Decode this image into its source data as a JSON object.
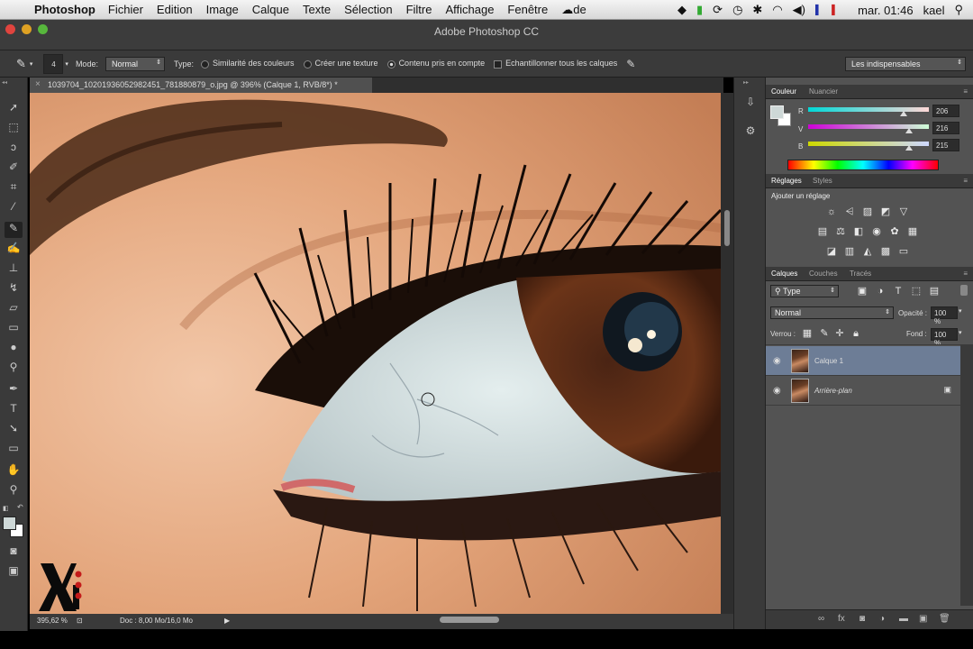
{
  "menubar": {
    "app": "Photoshop",
    "menus": [
      "Fichier",
      "Edition",
      "Image",
      "Calque",
      "Texte",
      "Sélection",
      "Filtre",
      "Affichage",
      "Fenêtre",
      "de"
    ],
    "clock": "mar. 01:46",
    "user": "kael"
  },
  "window": {
    "title": "Adobe Photoshop CC"
  },
  "options": {
    "mode_label": "Mode:",
    "mode_value": "Normal",
    "type_label": "Type:",
    "radio1": "Similarité des couleurs",
    "radio2": "Créer une texture",
    "radio3": "Contenu pris en compte",
    "checkbox": "Echantillonner tous les calques",
    "brush_size": "4",
    "workspace": "Les indispensables"
  },
  "document": {
    "tab": "1039704_10201936052982451_781880879_o.jpg @ 396% (Calque 1, RVB/8*) *"
  },
  "status": {
    "zoom": "395,62 %",
    "doc": "Doc : 8,00 Mo/16,0 Mo"
  },
  "color_panel": {
    "tab1": "Couleur",
    "tab2": "Nuancier",
    "r_label": "R",
    "v_label": "V",
    "b_label": "B",
    "r": "206",
    "v": "216",
    "b": "215",
    "foreground": "#ced8d7"
  },
  "adjustments_panel": {
    "tab1": "Réglages",
    "tab2": "Styles",
    "heading": "Ajouter un réglage"
  },
  "layers_panel": {
    "tab1": "Calques",
    "tab2": "Couches",
    "tab3": "Tracés",
    "filter": "Type",
    "blend": "Normal",
    "opacity_label": "Opacité :",
    "opacity": "100 %",
    "lock_label": "Verrou :",
    "fill_label": "Fond :",
    "fill": "100 %",
    "layers": [
      {
        "name": "Calque 1",
        "selected": true
      },
      {
        "name": "Arrière-plan",
        "selected": false
      }
    ]
  },
  "colors": {
    "selection": "#6d7d96",
    "panel": "#535353",
    "dark": "#3a3a3a"
  }
}
